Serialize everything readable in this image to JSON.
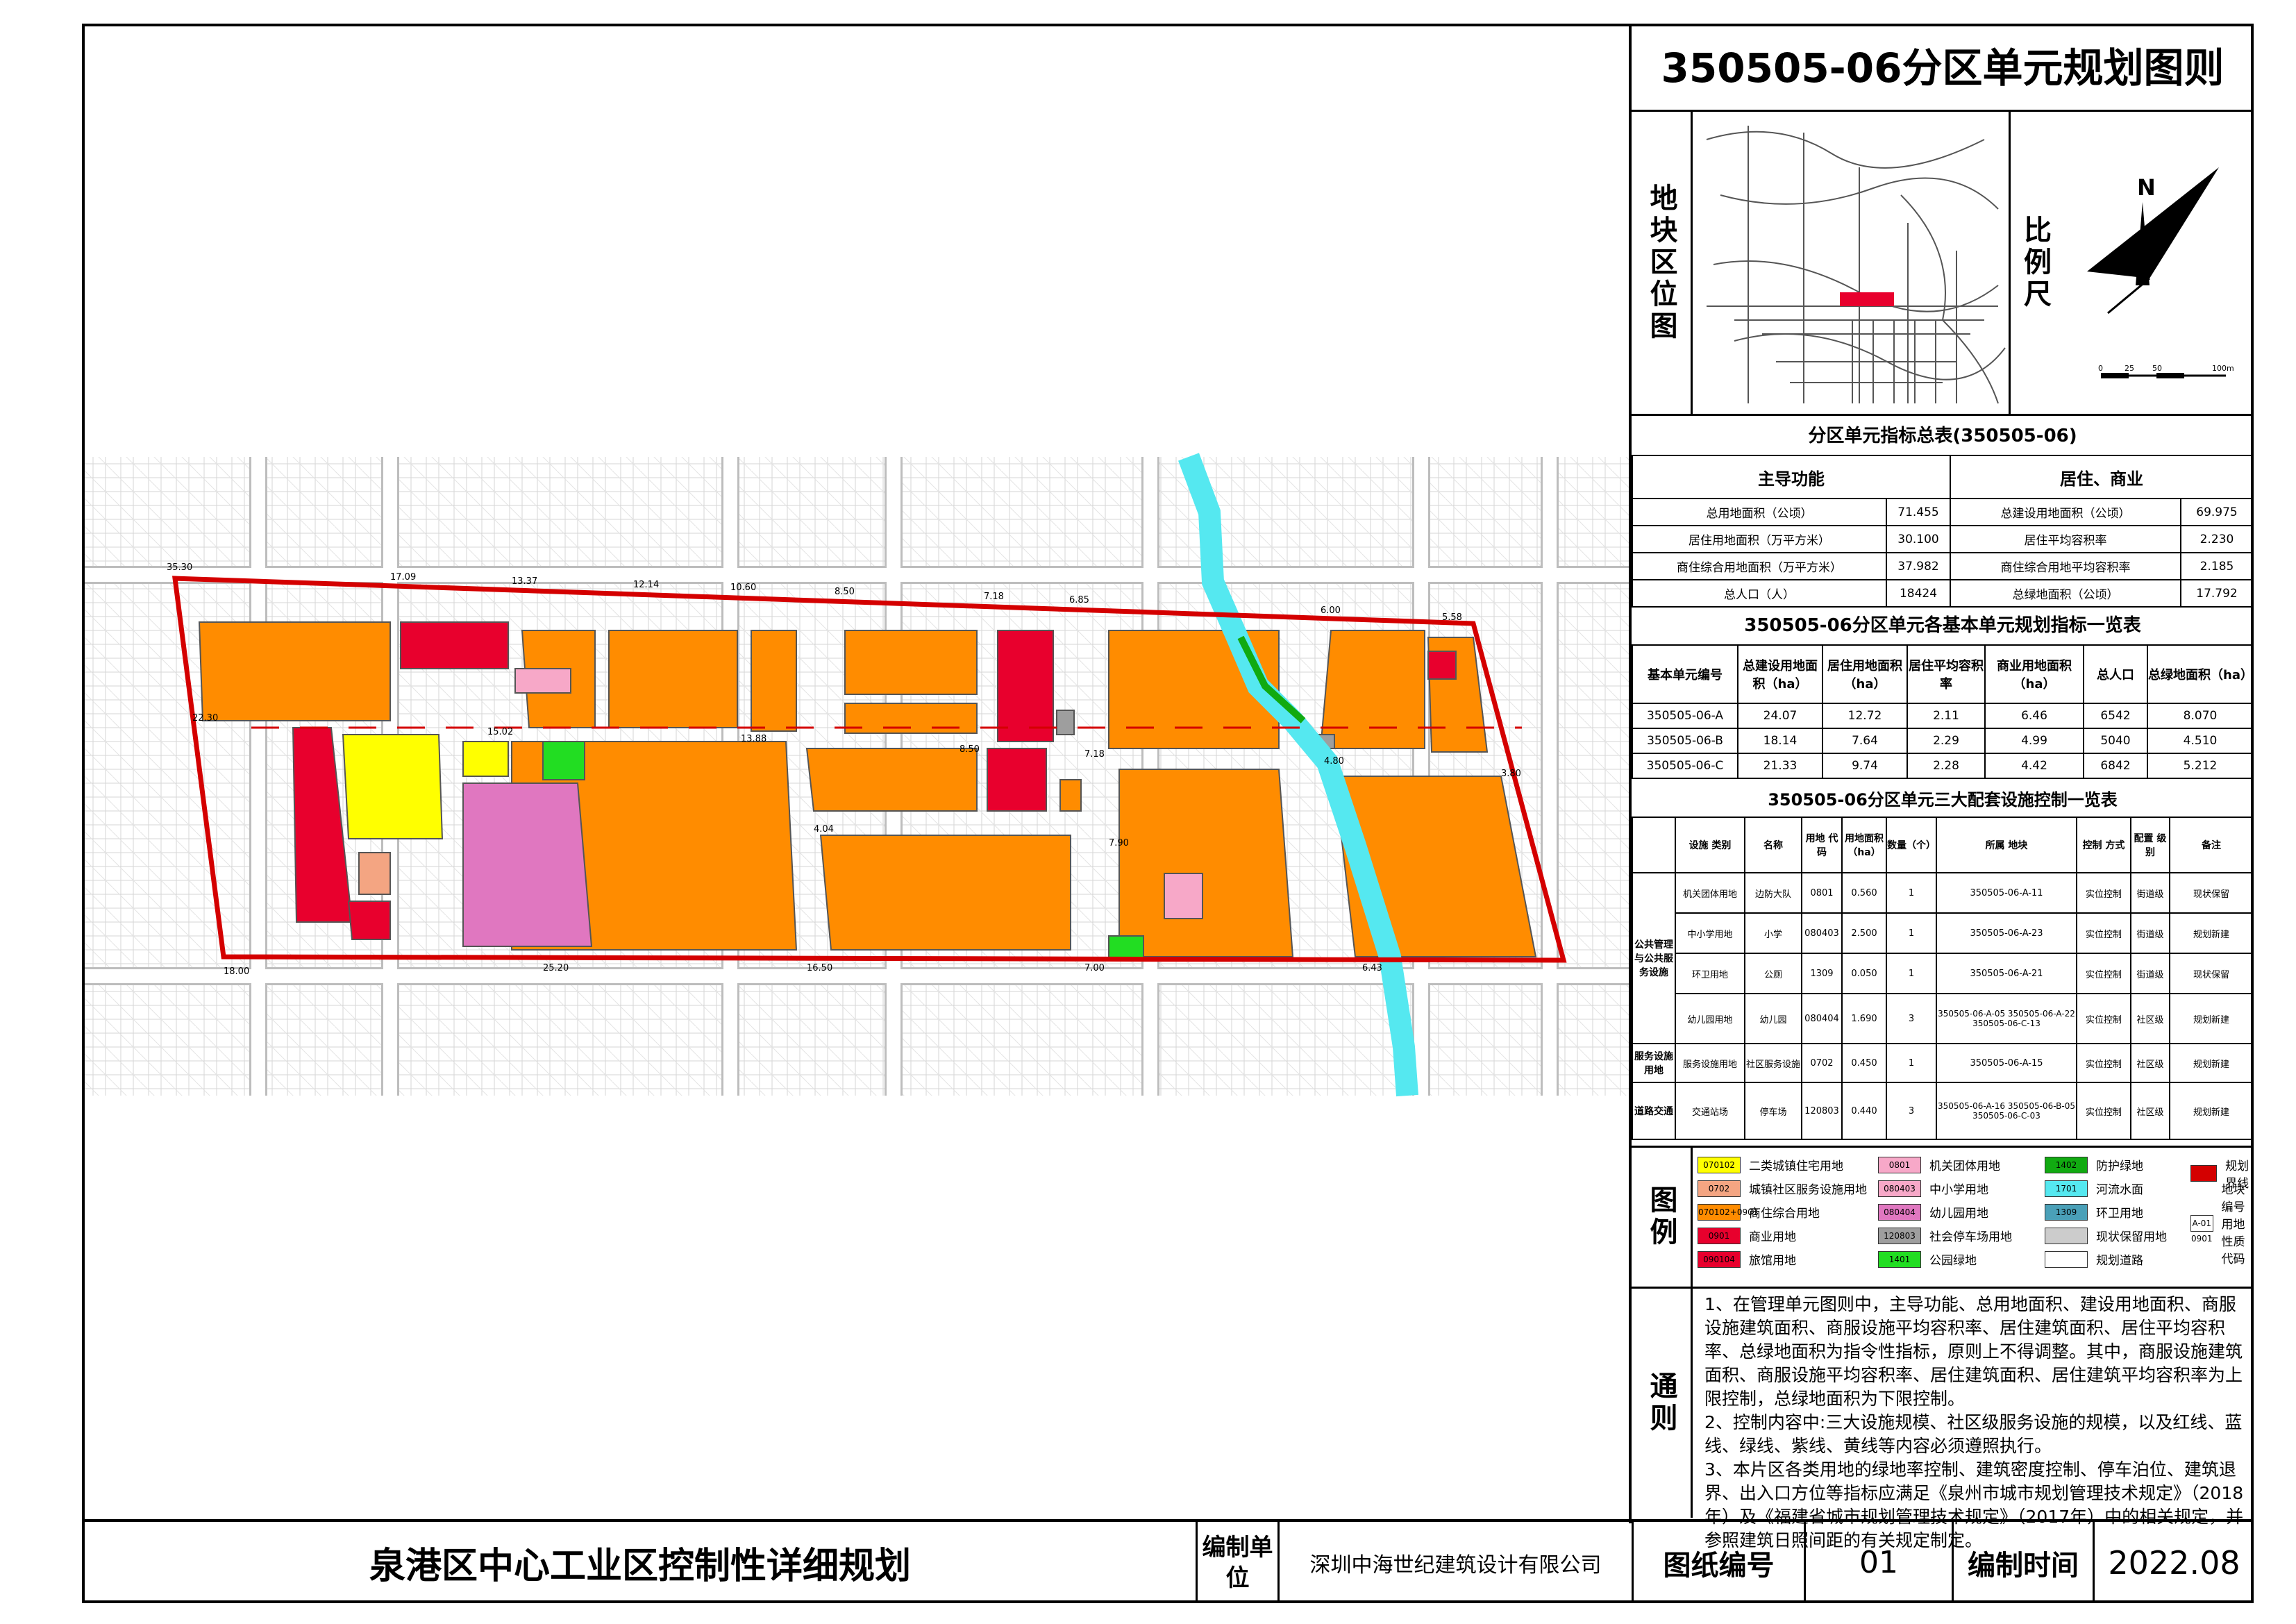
{
  "plan_title": "泉港区中心工业区控制性详细规划",
  "sheet_title": "350505-06分区单元规划图则",
  "location_label": "地块区位图",
  "scale_label": "比例尺",
  "north_label": "N",
  "scale_ticks": [
    "0",
    "25",
    "50",
    "100m"
  ],
  "summary": {
    "caption": "分区单元指标总表(350505-06)",
    "main_function_label": "主导功能",
    "main_function_value": "居住、商业",
    "rows": [
      [
        "总用地面积（公顷）",
        "71.455",
        "总建设用地面积（公顷）",
        "69.975"
      ],
      [
        "居住用地面积（万平方米）",
        "30.100",
        "居住平均容积率",
        "2.230"
      ],
      [
        "商住综合用地面积（万平方米）",
        "37.982",
        "商住综合用地平均容积率",
        "2.185"
      ],
      [
        "总人口（人）",
        "18424",
        "总绿地面积（公顷）",
        "17.792"
      ]
    ]
  },
  "units": {
    "caption": "350505-06分区单元各基本单元规划指标一览表",
    "headers": [
      "基本单元编号",
      "总建设用地面积（ha）",
      "居住用地面积（ha）",
      "居住平均容积率",
      "商业用地面积（ha）",
      "总人口",
      "总绿地面积（ha）"
    ],
    "rows": [
      [
        "350505-06-A",
        "24.07",
        "12.72",
        "2.11",
        "6.46",
        "6542",
        "8.070"
      ],
      [
        "350505-06-B",
        "18.14",
        "7.64",
        "2.29",
        "4.99",
        "5040",
        "4.510"
      ],
      [
        "350505-06-C",
        "21.33",
        "9.74",
        "2.28",
        "4.42",
        "6842",
        "5.212"
      ]
    ]
  },
  "facilities": {
    "caption": "350505-06分区单元三大配套设施控制一览表",
    "headers": [
      "设施 类别",
      "名称",
      "用地 代码",
      "用地面积（ha）",
      "数量（个）",
      "所属 地块",
      "控制 方式",
      "配置 级别",
      "备注"
    ],
    "groups": [
      {
        "category": "公共管理与公共服务设施",
        "rows": [
          [
            "机关团体用地",
            "边防大队",
            "0801",
            "0.560",
            "1",
            "350505-06-A-11",
            "实位控制",
            "街道级",
            "现状保留"
          ],
          [
            "中小学用地",
            "小学",
            "080403",
            "2.500",
            "1",
            "350505-06-A-23",
            "实位控制",
            "街道级",
            "规划新建"
          ],
          [
            "环卫用地",
            "公厕",
            "1309",
            "0.050",
            "1",
            "350505-06-A-21",
            "实位控制",
            "街道级",
            "现状保留"
          ],
          [
            "幼儿园用地",
            "幼儿园",
            "080404",
            "1.690",
            "3",
            "350505-06-A-05 350505-06-A-22 350505-06-C-13",
            "实位控制",
            "社区级",
            "规划新建"
          ]
        ]
      },
      {
        "category": "服务设施用地",
        "rows": [
          [
            "服务设施用地",
            "社区服务设施",
            "0702",
            "0.450",
            "1",
            "350505-06-A-15",
            "实位控制",
            "社区级",
            "规划新建"
          ]
        ]
      },
      {
        "category": "道路交通",
        "rows": [
          [
            "交通站场",
            "停车场",
            "120803",
            "0.440",
            "3",
            "350505-06-A-16 350505-06-B-05 350505-06-C-03",
            "实位控制",
            "社区级",
            "规划新建"
          ]
        ]
      }
    ]
  },
  "legend": {
    "label": "图例",
    "items": [
      {
        "code": "070102",
        "name": "二类城镇住宅用地",
        "color": "#ffff00"
      },
      {
        "code": "0702",
        "name": "城镇社区服务设施用地",
        "color": "#f4a582"
      },
      {
        "code": "070102+0901",
        "name": "商住综合用地",
        "color": "#ff8c00"
      },
      {
        "code": "0901",
        "name": "商业用地",
        "color": "#e8002d"
      },
      {
        "code": "090104",
        "name": "旅馆用地",
        "color": "#e8002d"
      },
      {
        "code": "0801",
        "name": "机关团体用地",
        "color": "#f7a8c8"
      },
      {
        "code": "080403",
        "name": "中小学用地",
        "color": "#f7a8c8"
      },
      {
        "code": "080404",
        "name": "幼儿园用地",
        "color": "#e077c0"
      },
      {
        "code": "120803",
        "name": "社会停车场用地",
        "color": "#9e9e9e"
      },
      {
        "code": "1401",
        "name": "公园绿地",
        "color": "#22dd22"
      },
      {
        "code": "1402",
        "name": "防护绿地",
        "color": "#11aa11"
      },
      {
        "code": "1701",
        "name": "河流水面",
        "color": "#55e8f0"
      },
      {
        "code": "1309",
        "name": "环卫用地",
        "color": "#4aa0b8"
      },
      {
        "code": "",
        "name": "现状保留用地",
        "color": "#cccccc"
      },
      {
        "code": "",
        "name": "规划道路",
        "color": "#ffffff"
      },
      {
        "code": "",
        "name": "规划界线",
        "color": "#d40000"
      },
      {
        "code": "A-01 0901",
        "name": "地块编号 用地性质代码",
        "color": "#ffffff"
      }
    ]
  },
  "notes": {
    "label": "通则",
    "paragraphs": [
      "1、在管理单元图则中，主导功能、总用地面积、建设用地面积、商服设施建筑面积、商服设施平均容积率、居住建筑面积、居住平均容积率、总绿地面积为指令性指标，原则上不得调整。其中，商服设施建筑面积、商服设施平均容积率、居住建筑面积、居住建筑平均容积率为上限控制，总绿地面积为下限控制。",
      "2、控制内容中:三大设施规模、社区级服务设施的规模，以及红线、蓝线、绿线、紫线、黄线等内容必须遵照执行。",
      "3、本片区各类用地的绿地率控制、建筑密度控制、停车泊位、建筑退界、出入口方位等指标应满足《泉州市城市规划管理技术规定》（2018年）及《福建省城市规划管理技术规定》（2017年）中的相关规定，并参照建筑日照间距的有关规定制定。"
    ]
  },
  "footer": {
    "designer_label": "编制单位",
    "designer": "深圳中海世纪建筑设计有限公司",
    "drawing_no_label": "图纸编号",
    "drawing_no": "01",
    "date_label": "编制时间",
    "date": "2022.08"
  },
  "map_colors": {
    "mixed": "#ff8c00",
    "commercial": "#e8002d",
    "residential": "#ffff00",
    "school": "#f7a8c8",
    "kindergarten": "#e077c0",
    "green": "#22dd22",
    "water": "#55e8f0",
    "parking": "#9e9e9e",
    "boundary": "#d40000"
  },
  "map_labels": [
    "35.30",
    "17.09",
    "13.37",
    "12.14",
    "10.60",
    "8.50",
    "7.18",
    "6.85",
    "6.00",
    "5.58",
    "22.30",
    "15.02",
    "13.88",
    "8.50",
    "7.18",
    "4.80",
    "3.80",
    "4.04",
    "7.90",
    "18.00",
    "25.20",
    "16.50",
    "7.00",
    "6.43"
  ]
}
